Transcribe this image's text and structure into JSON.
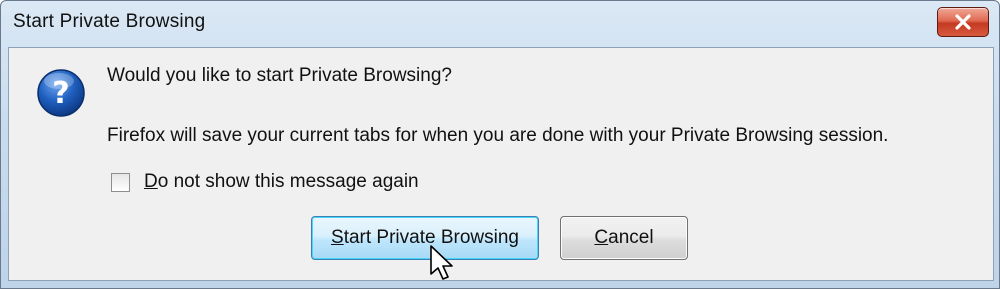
{
  "window": {
    "title": "Start Private Browsing"
  },
  "dialog": {
    "icon": "question-icon",
    "question": "Would you like to start Private Browsing?",
    "message": "Firefox will save your current tabs for when you are done with your Private Browsing session.",
    "checkbox": {
      "label_first_letter": "D",
      "label_rest": "o not show this message again",
      "checked": false
    }
  },
  "buttons": {
    "start": {
      "first_letter": "S",
      "rest": "tart Private Browsing"
    },
    "cancel": {
      "first_letter": "C",
      "rest": "ancel"
    }
  },
  "colors": {
    "close_button": "#d75a3e",
    "question_icon": "#1f5fbf",
    "default_button_border": "#3c7fb1"
  }
}
